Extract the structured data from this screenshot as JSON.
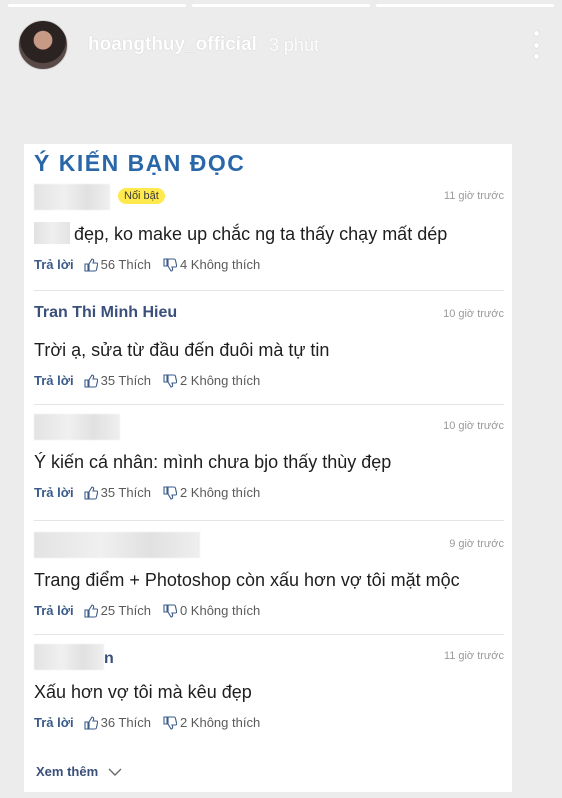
{
  "story": {
    "username": "hoangthuy_official",
    "time": "3 phút",
    "progress_segments": 3
  },
  "section_title": "Ý KIẾN BẠN ĐỌC",
  "labels": {
    "reply": "Trả lời",
    "like_suffix": "Thích",
    "dislike_suffix": "Không thích",
    "see_more": "Xem thêm"
  },
  "comments": [
    {
      "name": "",
      "name_partial": "",
      "badge": "Nổi bật",
      "time": "11 giờ trước",
      "text": "đẹp, ko make up chắc ng ta thấy chạy mất dép",
      "likes": "56",
      "dislikes": "4",
      "like_text": "56 Thích",
      "dislike_text": "4 Không thích"
    },
    {
      "name": "Tran Thi Minh Hieu",
      "time": "10 giờ trước",
      "text": "Trời ạ, sửa từ đầu đến đuôi mà tự tin",
      "like_text": "35 Thích",
      "dislike_text": "2 Không thích"
    },
    {
      "name": "",
      "time": "10 giờ trước",
      "text": "Ý kiến cá nhân: mình chưa bjo thấy thùy đẹp",
      "like_text": "35 Thích",
      "dislike_text": "2 Không thích"
    },
    {
      "name": "",
      "time": "9 giờ trước",
      "text": "Trang điểm + Photoshop còn xấu hơn vợ tôi mặt mộc",
      "like_text": "25 Thích",
      "dislike_text": "0 Không thích"
    },
    {
      "name": "",
      "name_tail": "n",
      "time": "11 giờ trước",
      "text": "Xấu hơn vợ tôi mà kêu đẹp",
      "like_text": "36 Thích",
      "dislike_text": "2 Không thích"
    }
  ],
  "colors": {
    "title_blue": "#2a67a8",
    "name_blue": "#3a4f7a",
    "badge_yellow": "#ffe94d",
    "timestamp_gray": "#9a9a9a"
  },
  "icons": {
    "like": "thumbs-up-icon",
    "dislike": "thumbs-down-icon",
    "more": "more-vertical-icon",
    "see_more": "chevron-down-icon"
  }
}
